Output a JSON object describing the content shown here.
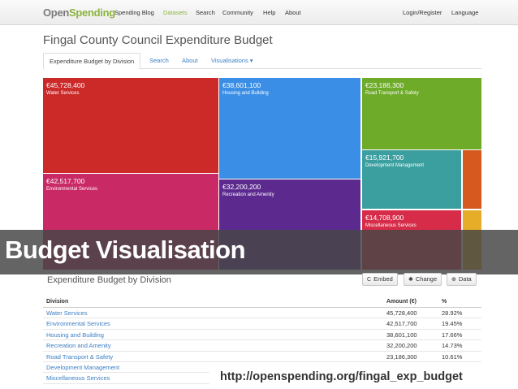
{
  "nav": {
    "logo_part1": "Open",
    "logo_part2": "Spending",
    "links": [
      "Spending Blog",
      "Datasets",
      "Search",
      "Community",
      "Help",
      "About"
    ],
    "active": "Datasets",
    "login": "Login/Register",
    "language": "Language"
  },
  "page_title": "Fingal County Council Expenditure Budget",
  "tabs": [
    "Expenditure Budget by Division",
    "Search",
    "About",
    "Visualisations ▾"
  ],
  "treemap": {
    "cells": [
      {
        "amount": "€45,728,400",
        "label": "Water Services",
        "color": "#cc2929"
      },
      {
        "amount": "€38,601,100",
        "label": "Housing and Building",
        "color": "#3b8ee6"
      },
      {
        "amount": "€23,186,300",
        "label": "Road Transport & Safety",
        "color": "#6dab28"
      },
      {
        "amount": "€42,517,700",
        "label": "Environmental Services",
        "color": "#c92a66"
      },
      {
        "amount": "€32,200,200",
        "label": "Recreation and Amenity",
        "color": "#5c2a8f"
      },
      {
        "amount": "€15,921,700",
        "label": "Development Management",
        "color": "#3b9fa0"
      },
      {
        "amount": "€14,708,900",
        "label": "Miscellaneous Services",
        "color": "#d62c49"
      },
      {
        "amount": "",
        "label": "",
        "color": "#d6591f"
      },
      {
        "amount": "",
        "label": "",
        "color": "#e6ad28"
      }
    ]
  },
  "banner": "Budget Visualisation",
  "section": {
    "title": "Expenditure Budget by Division",
    "buttons": [
      {
        "icon": "C",
        "label": "Embed"
      },
      {
        "icon": "✱",
        "label": "Change"
      },
      {
        "icon": "⊕",
        "label": "Data"
      }
    ]
  },
  "table": {
    "headers": [
      "Division",
      "Amount (€)",
      "%"
    ],
    "rows": [
      {
        "division": "Water Services",
        "amount": "45,728,400",
        "pct": "28.92%"
      },
      {
        "division": "Environmental Services",
        "amount": "42,517,700",
        "pct": "19.45%"
      },
      {
        "division": "Housing and Building",
        "amount": "38,601,100",
        "pct": "17.66%"
      },
      {
        "division": "Recreation and Amenity",
        "amount": "32,200,200",
        "pct": "14.73%"
      },
      {
        "division": "Road Transport & Safety",
        "amount": "23,186,300",
        "pct": "10.61%"
      },
      {
        "division": "Development Management",
        "amount": "",
        "pct": ""
      },
      {
        "division": "Miscellaneous Services",
        "amount": "",
        "pct": ""
      }
    ]
  },
  "footer_url": "http://openspending.org/fingal_exp_budget"
}
